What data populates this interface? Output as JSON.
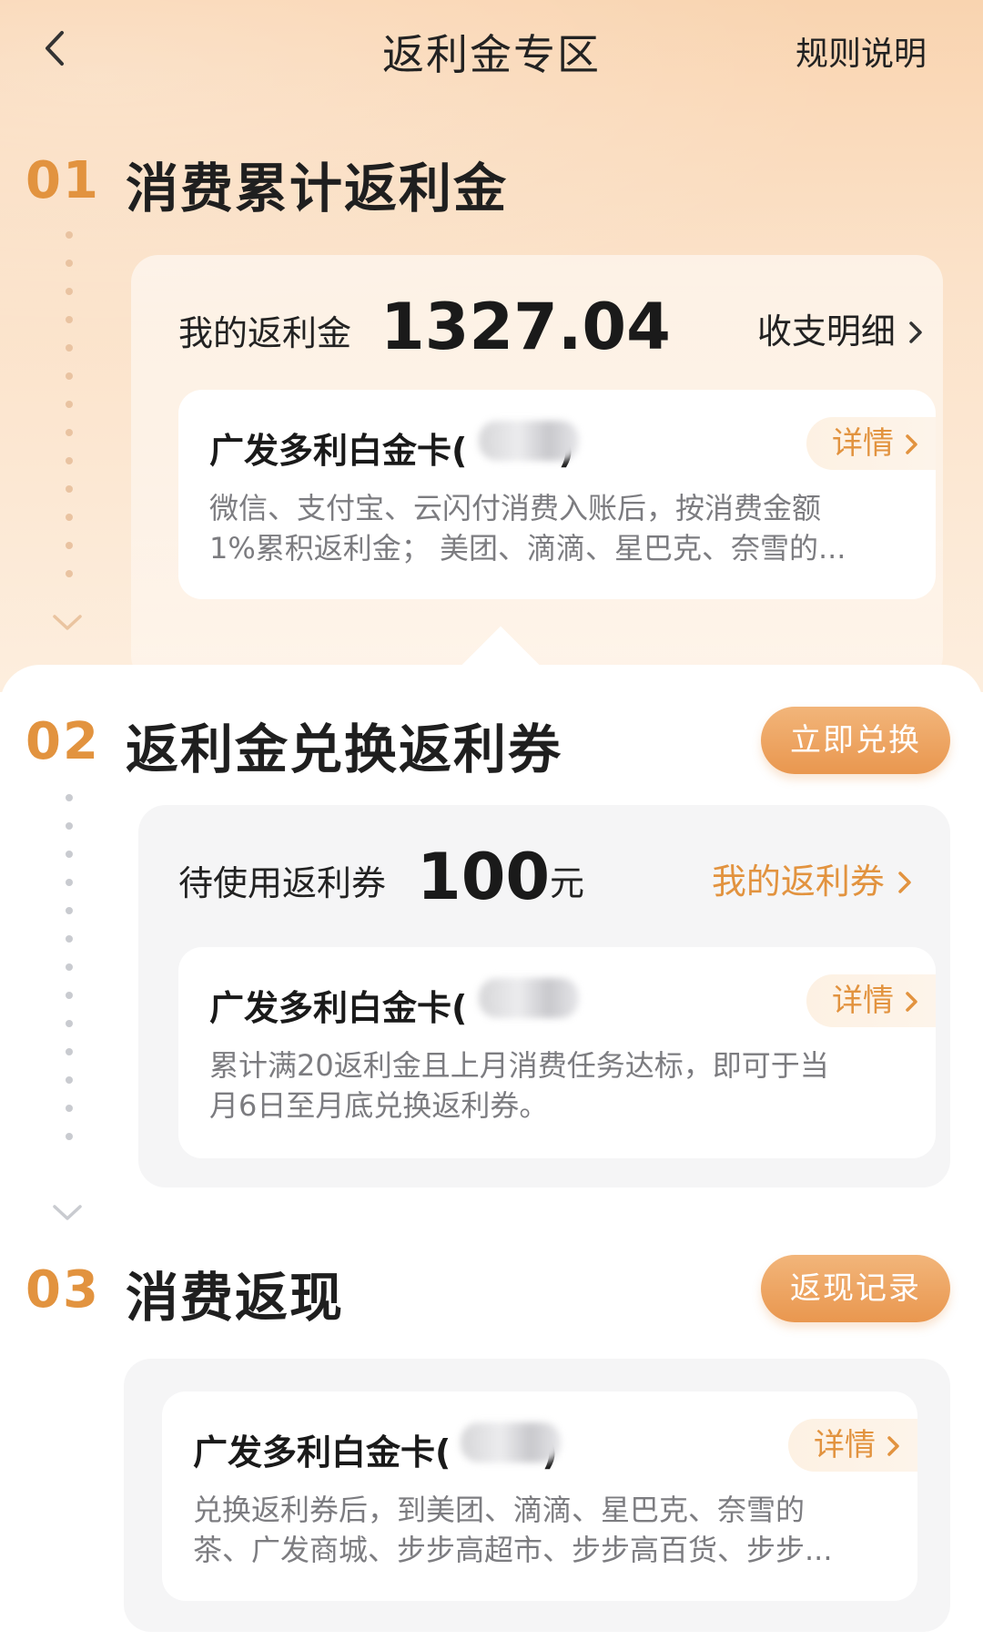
{
  "nav": {
    "title": "返利金专区",
    "rules": "规则说明"
  },
  "section1": {
    "num": "01",
    "title": "消费累计返利金",
    "balance_label": "我的返利金",
    "balance_amount": "1327.04",
    "link": "收支明细",
    "card_name": "广发多利白金卡(",
    "card_name_end": ")",
    "detail": "详情",
    "desc_line1": "微信、支付宝、云闪付消费入账后，按消费金额",
    "desc_line2": "1%累积返利金； 美团、滴滴、星巴克、奈雪的..."
  },
  "section2": {
    "num": "02",
    "title": "返利金兑换返利券",
    "button": "立即兑换",
    "balance_label": "待使用返利券",
    "balance_amount": "100",
    "unit": "元",
    "link": "我的返利券",
    "card_name": "广发多利白金卡(",
    "detail": "详情",
    "desc_line1": "累计满20返利金且上月消费任务达标，即可于当",
    "desc_line2": "月6日至月底兑换返利券。"
  },
  "section3": {
    "num": "03",
    "title": "消费返现",
    "button": "返现记录",
    "card_name": "广发多利白金卡(",
    "card_name_end": ")",
    "detail": "详情",
    "desc_line1": "兑换返利券后，到美团、滴滴、星巴克、奈雪的",
    "desc_line2": "茶、广发商城、步步高超市、步步高百货、步步..."
  },
  "colors": {
    "accent": "#e2933f",
    "button": "#eba05c",
    "dot": "#c9cbd0"
  },
  "icons": [
    "back-arrow-icon",
    "chevron-right-icon",
    "chevron-down-icon"
  ]
}
